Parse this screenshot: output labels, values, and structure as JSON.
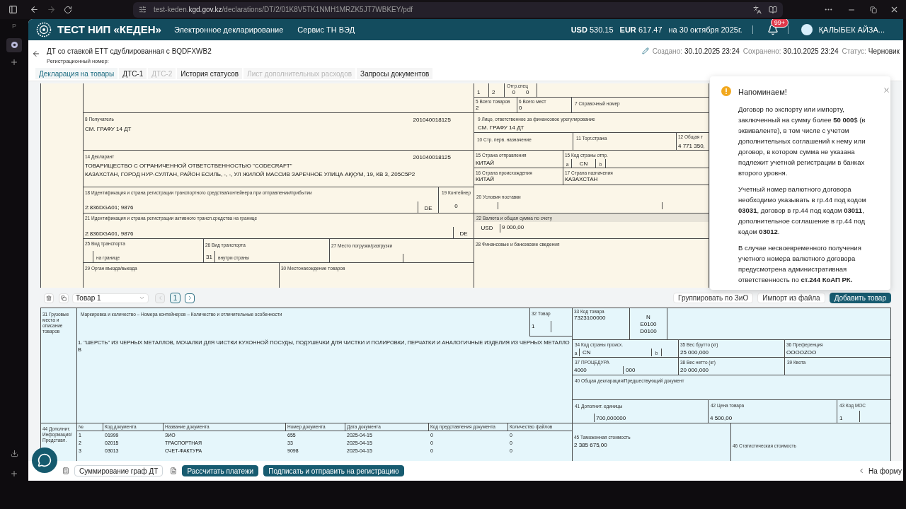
{
  "browser": {
    "url": "test-keden.**kgd.gov.kz**/declarations/DT/2/01K8V5TK1NMH1MRZK5JT7WBKEY/pdf",
    "side_letter": "P"
  },
  "header": {
    "brand": "ТЕСТ НИП «КЕДЕН»",
    "nav": [
      "Электронное декларирование",
      "Сервис ТН ВЭД"
    ],
    "rates": [
      {
        "currency": "USD",
        "value": "530.15"
      },
      {
        "currency": "EUR",
        "value": "617.47"
      }
    ],
    "rate_date": "на 30 октября 2025г.",
    "notification_badge": "99+",
    "user": "ҚАЛЫБЕК АЙЗА..."
  },
  "document": {
    "title": "ДТ со ставкой ЕТТ сдублированная с BQDFXWB2",
    "reg_label": "Регистрационный номер:",
    "meta": [
      {
        "label": "Создано:",
        "value": "30.10.2025 23:24"
      },
      {
        "label": "Сохранено:",
        "value": "30.10.2025 23:24"
      },
      {
        "label": "Статус:",
        "value": "Черновик"
      }
    ],
    "tabs": [
      {
        "label": "Декларация на товары",
        "selected": true,
        "disabled": false
      },
      {
        "label": "ДТС-1",
        "selected": false,
        "disabled": false
      },
      {
        "label": "ДТС-2",
        "selected": false,
        "disabled": true
      },
      {
        "label": "История статусов",
        "selected": false,
        "disabled": false
      },
      {
        "label": "Лист дополнительных расходов",
        "selected": false,
        "disabled": true
      },
      {
        "label": "Запросы документов",
        "selected": false,
        "disabled": false
      }
    ]
  },
  "form_main": {
    "ship_spec": {
      "label": "Отгр.спец",
      "values": [
        "1",
        "2",
        "0",
        "0"
      ]
    },
    "box_5": {
      "label": "5 Всего товаров",
      "value": "2"
    },
    "box_6": {
      "label": "6 Всего мест",
      "value": "0"
    },
    "box_7": {
      "label": "7 Справочный номер"
    },
    "box_8": {
      "label": "8 Получатель",
      "code": "201040018125",
      "lines": [
        "СМ. ГРАФУ 14 ДТ"
      ]
    },
    "box_9": {
      "label": "9 Лицо, ответственное за финансовое урегулирование",
      "value": "СМ. ГРАФУ 14 ДТ"
    },
    "box_10": {
      "label": "10 Стр. перв. назначение"
    },
    "box_11": {
      "label": "11 Торг.страна"
    },
    "box_12": {
      "label": "12 Общая т",
      "value": "4 771 350,"
    },
    "box_14": {
      "label": "14 Декларант",
      "code": "201040018125",
      "lines": [
        "ТОВАРИЩЕСТВО С ОГРАНИЧЕННОЙ ОТВЕТСТВЕННОСТЬЮ \"CODECRAFT\"",
        "КАЗАХСТАН, ГОРОД НУР-СУЛТАН, РАЙОН ЕСИЛЬ, -, -, УЛ ЖИЛОЙ МАССИВ ЗАРЕЧНОЕ УЛИЦА АҚҚУМ, 19, КВ 3, Z05C5P2"
      ]
    },
    "box_15": {
      "label": "15 Страна отправления",
      "value": "КИТАЙ"
    },
    "box_15_code": {
      "label": "15 Код страны отпр.",
      "a_label": "a",
      "a": "CN",
      "b_label": "b"
    },
    "box_16": {
      "label": "16 Страна происхождения",
      "value": "КИТАЙ"
    },
    "box_17": {
      "label": "17 Страна назначения",
      "value": "КАЗАХСТАН"
    },
    "box_18": {
      "label": "18 Идентификация и страна регистрации транспортного средства/контейнера при отправлении/прибытии",
      "value": "2:836DGA01; 9876",
      "country": "DE"
    },
    "box_19": {
      "label": "19 Контейнер",
      "value": "0"
    },
    "box_20": {
      "label": "20 Условия поставки"
    },
    "box_21": {
      "label": "21 Идентификация и страна регистрации активного трансп.средства на границе",
      "value": "2:836DGA01, 9876",
      "country": "DE"
    },
    "box_22": {
      "label": "22 Валюта и общая сумма по счету",
      "currency": "USD",
      "amount": "9 000,00"
    },
    "box_25": {
      "label": "25 Вид транспорта",
      "sub": "на границе"
    },
    "box_26": {
      "label": "26 Вид транспорта",
      "value": "31",
      "sub": "внутри страны"
    },
    "box_27": {
      "label": "27 Место погрузки/разгрузки"
    },
    "box_28": {
      "label": "28 Финансовые и банковские сведения"
    },
    "box_29": {
      "label": "29 Орган въезда/выезда"
    },
    "box_30": {
      "label": "30 Местонахождение товаров"
    }
  },
  "toast": {
    "title": "Напоминаем!",
    "paragraphs": [
      "Договор по экспорту или импорту, заключенный на сумму более **50 000**$ (в эквиваленте), в том числе с учетом дополнительных соглашений к нему или договор, в котором сумма не указана подлежит учетной регистрации в банках второго уровня.",
      "Учетный номер валютного договора необходимо указывать в гр.44 под кодом **03031**, договор в гр.44 под кодом **03011**, дополнительное соглашение в гр.44 под кодом **03012**.",
      "В случае несвоевременного получения учетного номера валютного договора предусмотрена административная ответственность по **ст.244 КоАП РК.**"
    ]
  },
  "item_toolbar": {
    "select": "Товар 1",
    "prev": {
      "disabled": true
    },
    "next": {
      "disabled": false
    },
    "pages": [
      {
        "label": "1",
        "selected": true
      }
    ],
    "actions": [
      {
        "label": "Группировать по ЗиО",
        "kind": "plain"
      },
      {
        "label": "Импорт из файла",
        "kind": "plain"
      },
      {
        "label": "Добавить товар",
        "kind": "primary"
      }
    ]
  },
  "item_form": {
    "box_31": {
      "label": "31 Грузовые места и описание товаров",
      "header": "Маркировка и количество – Номера контейнеров – Количество и отличительные особенности",
      "description": "1. \"ШЕРСТЬ\" ИЗ ЧЕРНЫХ МЕТАЛЛОВ, МОЧАЛКИ ДЛЯ ЧИСТКИ КУХОННОЙ ПОСУДЫ, ПОДУШЕЧКИ ДЛЯ ЧИСТКИ И ПОЛИРОВКИ, ПЕРЧАТКИ И АНАЛОГИЧНЫЕ ИЗДЕЛИЯ ИЗ ЧЕРНЫХ МЕТАЛЛОВ"
    },
    "box_32": {
      "label": "32 Товар",
      "value": "1"
    },
    "box_33": {
      "label": "33 Код товара",
      "value": "7323100000",
      "extra": [
        "N",
        "E0100",
        "D0100"
      ]
    },
    "box_34": {
      "label": "34 Код страны происх.",
      "a_label": "a",
      "a": "CN",
      "b_label": "b"
    },
    "box_35": {
      "label": "35 Вес брутто (кг)",
      "value": "25 000,000"
    },
    "box_36": {
      "label": "36 Преференция",
      "value": "OOOOZOO"
    },
    "box_37": {
      "label": "37 ПРОЦЕДУРА",
      "value": "4000",
      "extra": "000"
    },
    "box_38": {
      "label": "38 Вес нетто (кг)",
      "value": "20 000,000"
    },
    "box_39": {
      "label": "39 Квота"
    },
    "box_40": {
      "label": "40 Общая декларация/Предшествующий документ"
    },
    "box_41": {
      "label": "41 Дополнит. единицы",
      "value": "700,000000"
    },
    "box_42": {
      "label": "42 Цена товара",
      "value": "4 500,00"
    },
    "box_43": {
      "label": "43 Код МОС",
      "value": "1"
    },
    "box_44": {
      "label": "44 Дополнит. Информация/ Представл.",
      "columns": [
        "№",
        "Код документа",
        "Название документа",
        "Номер документа",
        "Дата документа",
        "Код представления документа",
        "Количество файлов"
      ],
      "rows": [
        [
          "1",
          "01999",
          "ЗИО",
          "655",
          "2025-04-15",
          "0",
          "0"
        ],
        [
          "2",
          "02015",
          "ТРАСПОРТНАЯ",
          "33",
          "2025-04-15",
          "0",
          "0"
        ],
        [
          "3",
          "03013",
          "СЧЕТ-ФАКТУРА",
          "9098",
          "2025-04-15",
          "0",
          "0"
        ]
      ]
    },
    "box_45": {
      "label": "45 Таможенная стоимость",
      "value": "2 385 675,00"
    },
    "box_46": {
      "label": "46 Статистическая стоимость"
    }
  },
  "footer": {
    "buttons": [
      {
        "label": "Суммирование граф ДТ",
        "kind": "outline"
      },
      {
        "label": "Рассчитать платежи",
        "kind": "primary"
      },
      {
        "label": "Подписать и отправить на регистрацию",
        "kind": "primary"
      }
    ],
    "back_link": "На форму"
  }
}
